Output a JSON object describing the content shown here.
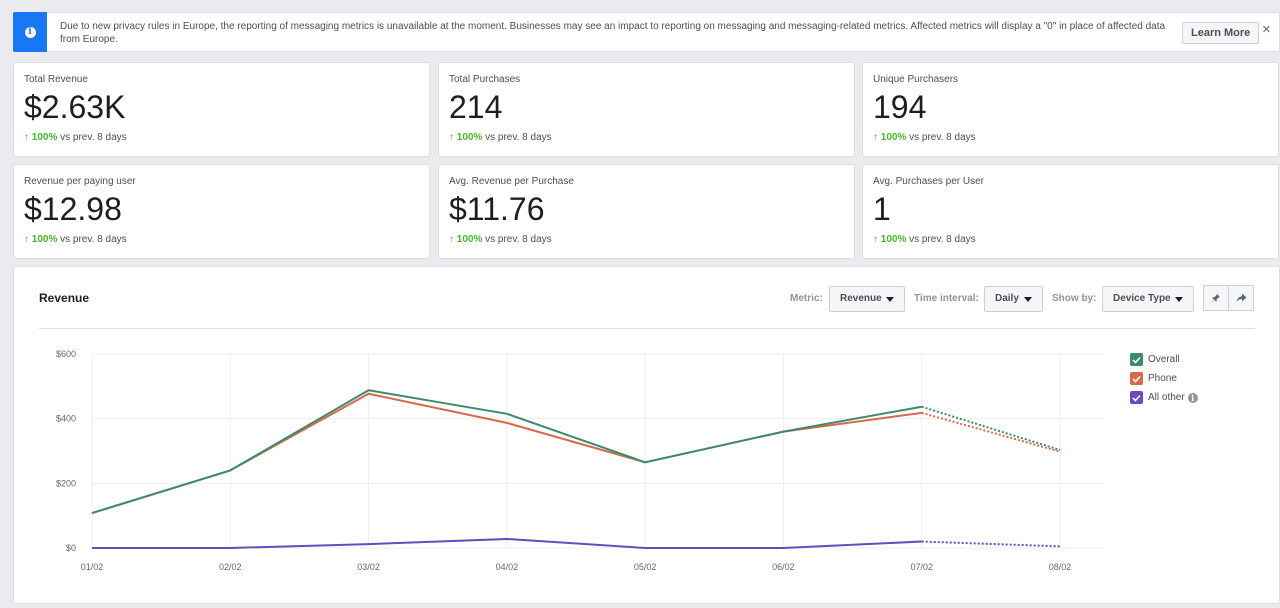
{
  "banner": {
    "message": "Due to new privacy rules in Europe, the reporting of messaging metrics is unavailable at the moment. Businesses may see an impact to reporting on messaging and messaging-related metrics. Affected metrics will display a \"0\" in place of affected data from Europe.",
    "learn_more": "Learn More",
    "close": "×",
    "info_icon": "i"
  },
  "cards": [
    {
      "label": "Total Revenue",
      "value": "$2.63K",
      "arrow": "↑",
      "pct": "100%",
      "compare": " vs prev. 8 days"
    },
    {
      "label": "Total Purchases",
      "value": "214",
      "arrow": "↑",
      "pct": "100%",
      "compare": " vs prev. 8 days"
    },
    {
      "label": "Unique Purchasers",
      "value": "194",
      "arrow": "↑",
      "pct": "100%",
      "compare": " vs prev. 8 days"
    },
    {
      "label": "Revenue per paying user",
      "value": "$12.98",
      "arrow": "↑",
      "pct": "100%",
      "compare": " vs prev. 8 days"
    },
    {
      "label": "Avg. Revenue per Purchase",
      "value": "$11.76",
      "arrow": "↑",
      "pct": "100%",
      "compare": " vs prev. 8 days"
    },
    {
      "label": "Avg. Purchases per User",
      "value": "1",
      "arrow": "↑",
      "pct": "100%",
      "compare": " vs prev. 8 days"
    }
  ],
  "chart_panel": {
    "title": "Revenue",
    "metric_label": "Metric:",
    "metric_value": "Revenue",
    "interval_label": "Time interval:",
    "interval_value": "Daily",
    "showby_label": "Show by:",
    "showby_value": "Device Type"
  },
  "colors": {
    "overall": "#3d8b6c",
    "phone": "#d6694c",
    "all_other": "#6a4ac1",
    "positive": "#42b72a",
    "accent": "#1877f2"
  },
  "chart_data": {
    "type": "line",
    "x": [
      "01/02",
      "02/02",
      "03/02",
      "04/02",
      "05/02",
      "06/02",
      "07/02",
      "08/02"
    ],
    "y_ticks": [
      "$0",
      "$200",
      "$400",
      "$600"
    ],
    "ylim": [
      0,
      600
    ],
    "projected_from_index": 6,
    "grid": true,
    "legend": "right",
    "series": [
      {
        "name": "Overall",
        "values": [
          108,
          240,
          488,
          415,
          265,
          360,
          437,
          303
        ]
      },
      {
        "name": "Phone",
        "values": [
          108,
          240,
          477,
          387,
          265,
          360,
          418,
          298
        ]
      },
      {
        "name": "All other",
        "values": [
          0,
          0,
          12,
          28,
          0,
          0,
          20,
          5
        ]
      }
    ]
  }
}
